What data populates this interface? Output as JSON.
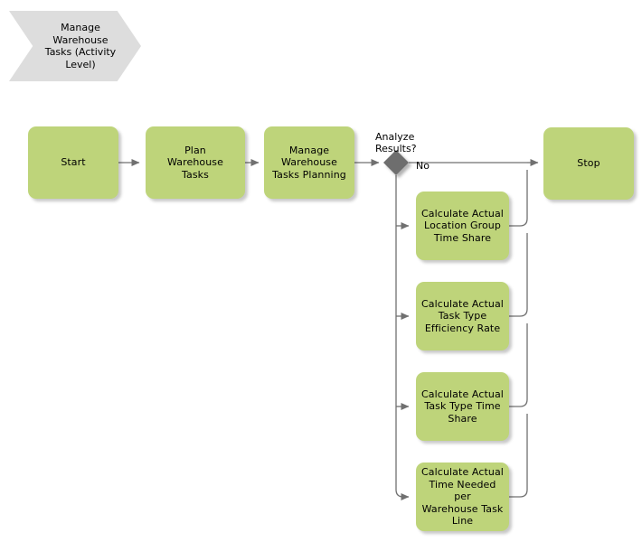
{
  "diagram": {
    "type": "flowchart",
    "title_banner": {
      "label": "Manage\nWarehouse\nTasks (Activity\nLevel)"
    },
    "colors": {
      "process_fill": "#bed47a",
      "banner_fill": "#dddddd",
      "decision_fill": "#6e6e6e",
      "connector": "#707070",
      "text": "#000000",
      "background": "#ffffff"
    },
    "nodes": {
      "start": {
        "label": "Start"
      },
      "plan_tasks": {
        "label": "Plan\nWarehouse\nTasks"
      },
      "manage_planning": {
        "label": "Manage\nWarehouse\nTasks Planning"
      },
      "decision": {
        "label": "Analyze\nResults?"
      },
      "stop": {
        "label": "Stop"
      },
      "branch_1": {
        "label": "Calculate Actual\nLocation Group\nTime Share"
      },
      "branch_2": {
        "label": "Calculate Actual\nTask Type\nEfficiency Rate"
      },
      "branch_3": {
        "label": "Calculate Actual\nTask Type Time\nShare"
      },
      "branch_4": {
        "label": "Calculate Actual\nTime Needed per\nWarehouse Task\nLine"
      }
    },
    "edges": {
      "no_label": "No"
    }
  }
}
